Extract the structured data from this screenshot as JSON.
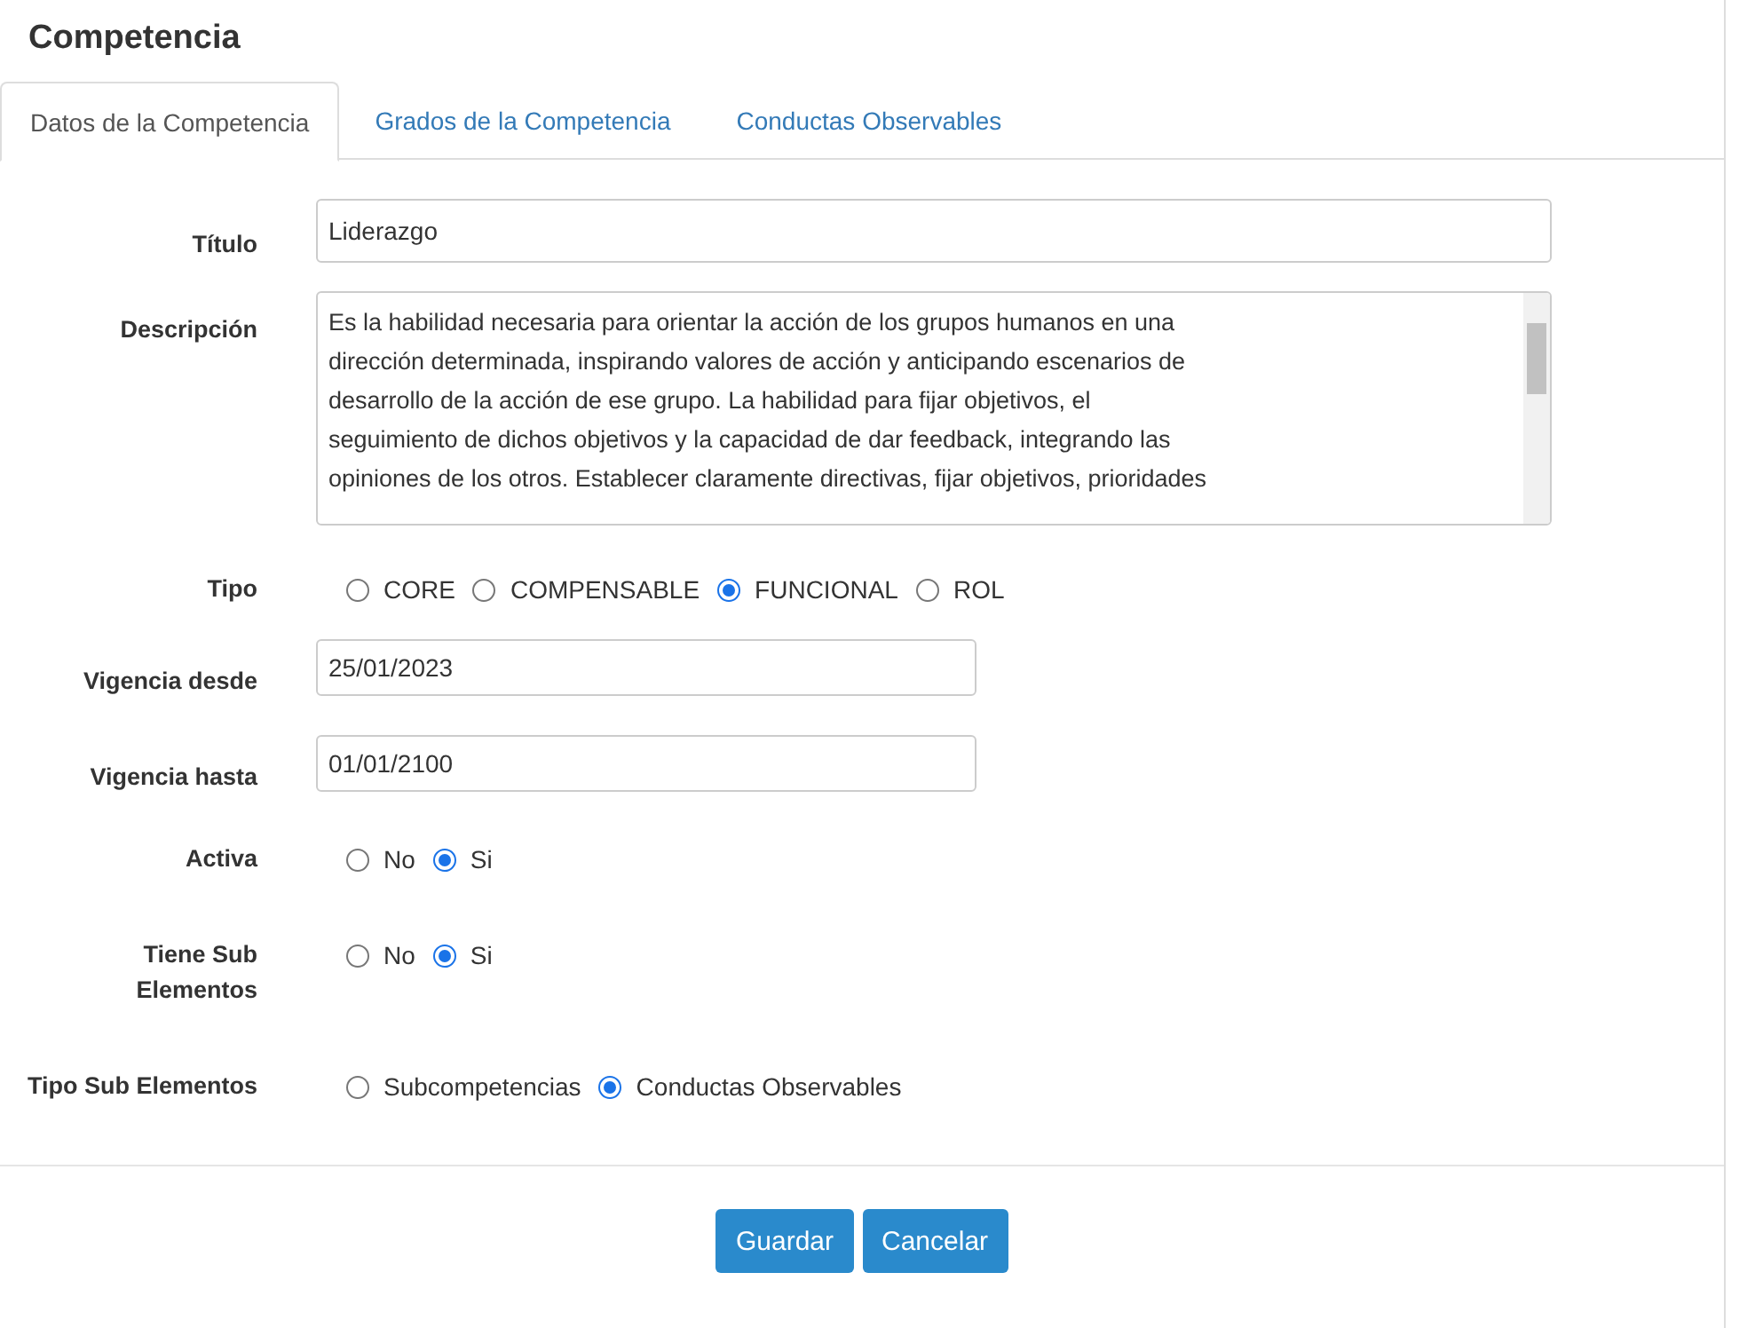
{
  "title": "Competencia",
  "tabs": [
    {
      "label": "Datos de la Competencia",
      "selected": true
    },
    {
      "label": "Grados de la Competencia",
      "selected": false
    },
    {
      "label": "Conductas Observables",
      "selected": false
    }
  ],
  "fields": [
    {
      "kind": "text",
      "label": "Título",
      "value": "Liderazgo"
    },
    {
      "kind": "textarea",
      "label": "Descripción",
      "lines": [
        "Es la habilidad necesaria para orientar la acción de los grupos humanos en una",
        "dirección determinada, inspirando valores de acción y anticipando escenarios de",
        "desarrollo de la acción de ese grupo. La habilidad para fijar objetivos, el",
        "seguimiento de dichos objetivos y la capacidad de dar feedback, integrando las",
        "opiniones de los otros. Establecer claramente directivas, fijar objetivos, prioridades"
      ]
    },
    {
      "kind": "radio",
      "label": "Tipo",
      "options": [
        {
          "label": "CORE",
          "selected": false
        },
        {
          "label": "COMPENSABLE",
          "selected": false
        },
        {
          "label": "FUNCIONAL",
          "selected": true
        },
        {
          "label": "ROL",
          "selected": false
        }
      ]
    },
    {
      "kind": "date",
      "label": "Vigencia desde",
      "value": "25/01/2023"
    },
    {
      "kind": "date",
      "label": "Vigencia hasta",
      "value": "01/01/2100"
    },
    {
      "kind": "radio",
      "label": "Activa",
      "options": [
        {
          "label": "No",
          "selected": false
        },
        {
          "label": "Si",
          "selected": true
        }
      ]
    },
    {
      "kind": "radio",
      "label": "Tiene Sub Elementos",
      "options": [
        {
          "label": "No",
          "selected": false
        },
        {
          "label": "Si",
          "selected": true
        }
      ]
    },
    {
      "kind": "radio",
      "label": "Tipo Sub Elementos",
      "options": [
        {
          "label": "Subcompetencias",
          "selected": false
        },
        {
          "label": "Conductas Observables",
          "selected": true
        }
      ]
    }
  ],
  "buttons": [
    "Guardar",
    "Cancelar"
  ]
}
